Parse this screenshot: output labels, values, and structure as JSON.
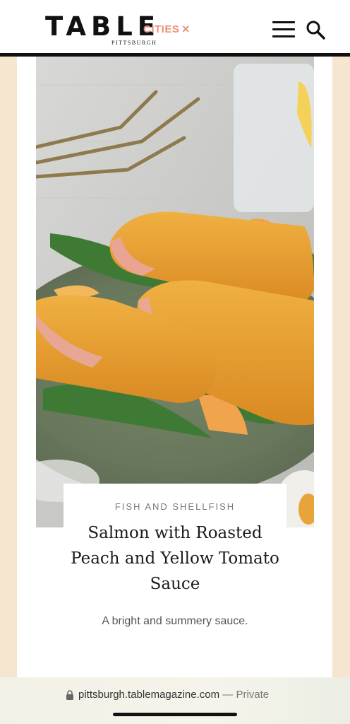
{
  "header": {
    "logo_main": "TABLE",
    "logo_sub": "PITTSBURGH",
    "cities_label": "CITIES",
    "cities_close": "×"
  },
  "article": {
    "category": "FISH AND SHELLFISH",
    "title": "Salmon with Roasted Peach and Yellow Tomato Sauce",
    "subtitle": "A bright and summery sauce."
  },
  "browser": {
    "url": "pittsburgh.tablemagazine.com",
    "separator": " — ",
    "privacy": "Private"
  },
  "icons": [
    "menu-icon",
    "search-icon",
    "lock-icon",
    "close-icon"
  ],
  "colors": {
    "accent": "#e8927a",
    "band": "#f6e6cf",
    "sauce": "#e9a23a",
    "plate": "#6f7f62"
  }
}
